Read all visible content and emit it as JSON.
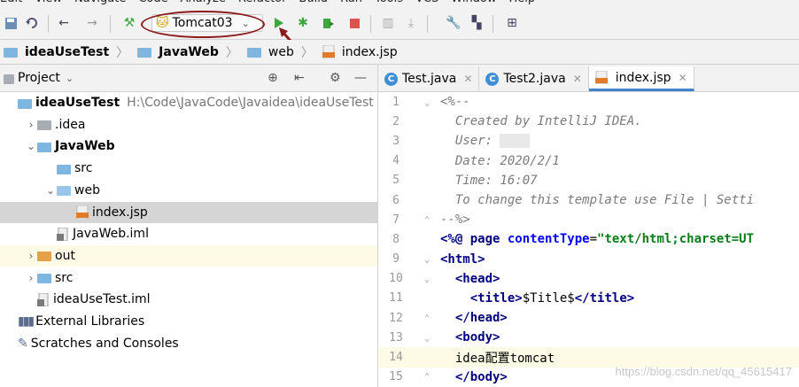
{
  "menu": [
    "Edit",
    "View",
    "Navigate",
    "Code",
    "Analyze",
    "Refactor",
    "Build",
    "Run",
    "Tools",
    "VCS",
    "Window",
    "Help"
  ],
  "toolbar": {
    "run_config": "Tomcat03",
    "icons": [
      "save-icon",
      "sync-icon",
      "back-icon",
      "forward-icon",
      "build-icon",
      "run-icon",
      "debug-icon",
      "coverage-icon",
      "stop-icon",
      "vcs-update-icon",
      "vcs-commit-icon",
      "settings-icon",
      "project-structure-icon",
      "sdk-icon"
    ]
  },
  "breadcrumbs": [
    {
      "label": "ideaUseTest",
      "bold": true
    },
    {
      "label": "JavaWeb",
      "bold": true
    },
    {
      "label": "web",
      "bold": false
    },
    {
      "label": "index.jsp",
      "bold": false
    }
  ],
  "project": {
    "header_label": "Project",
    "tree": [
      {
        "label": "ideaUseTest",
        "path": "H:\\Code\\JavaCode\\Javaidea\\ideaUseTest",
        "indent": 0,
        "chev": "",
        "icon": "module-folder",
        "bold": true
      },
      {
        "label": ".idea",
        "indent": 1,
        "chev": "›",
        "icon": "folder-grey"
      },
      {
        "label": "JavaWeb",
        "indent": 1,
        "chev": "⌄",
        "icon": "module-folder",
        "bold": true
      },
      {
        "label": "src",
        "indent": 2,
        "chev": "",
        "icon": "folder-blue"
      },
      {
        "label": "web",
        "indent": 2,
        "chev": "⌄",
        "icon": "folder-web"
      },
      {
        "label": "index.jsp",
        "indent": 3,
        "chev": "",
        "icon": "jsp-file",
        "selected": true
      },
      {
        "label": "JavaWeb.iml",
        "indent": 2,
        "chev": "",
        "icon": "iml-file"
      },
      {
        "label": "out",
        "indent": 1,
        "chev": "›",
        "icon": "folder-orange",
        "highlight": true
      },
      {
        "label": "src",
        "indent": 1,
        "chev": "›",
        "icon": "folder-blue"
      },
      {
        "label": "ideaUseTest.iml",
        "indent": 1,
        "chev": "",
        "icon": "iml-file"
      },
      {
        "label": "External Libraries",
        "indent": 0,
        "chev": "",
        "icon": "libraries"
      },
      {
        "label": "Scratches and Consoles",
        "indent": 0,
        "chev": "",
        "icon": "scratches"
      }
    ]
  },
  "editor": {
    "tabs": [
      {
        "label": "Test.java",
        "icon": "class-icon",
        "active": false
      },
      {
        "label": "Test2.java",
        "icon": "class-icon",
        "active": false
      },
      {
        "label": "index.jsp",
        "icon": "jsp-file",
        "active": true
      }
    ],
    "lines": [
      {
        "n": "1",
        "fold": "⌄",
        "html": "<span class='cmt'>&lt;%--</span>"
      },
      {
        "n": "2",
        "fold": "",
        "html": "<span class='cmt'>  Created by IntelliJ IDEA.</span>"
      },
      {
        "n": "3",
        "fold": "",
        "html": "<span class='cmt'>  User: </span><span style='background:#e8e8e8;color:#e8e8e8'>&#8203;xxxx</span>"
      },
      {
        "n": "4",
        "fold": "",
        "html": "<span class='cmt'>  Date: 2020/2/1</span>"
      },
      {
        "n": "5",
        "fold": "",
        "html": "<span class='cmt'>  Time: 16:07</span>"
      },
      {
        "n": "6",
        "fold": "",
        "html": "<span class='cmt'>  To change this template use File | Setti</span>"
      },
      {
        "n": "7",
        "fold": "⌃",
        "html": "<span class='cmt'>--%&gt;</span>"
      },
      {
        "n": "8",
        "fold": "",
        "html": "<span class='tag'>&lt;%@ page </span><span class='attr'>contentType</span>=<span class='str'>\"text/html;charset=UT</span>"
      },
      {
        "n": "9",
        "fold": "⌄",
        "html": "<span class='tag'>&lt;html&gt;</span>"
      },
      {
        "n": "10",
        "fold": "⌄",
        "html": "  <span class='tag'>&lt;head&gt;</span>"
      },
      {
        "n": "11",
        "fold": "",
        "html": "    <span class='tag'>&lt;title&gt;</span>$Title$<span class='tag'>&lt;/title&gt;</span>"
      },
      {
        "n": "12",
        "fold": "⌃",
        "html": "  <span class='tag'>&lt;/head&gt;</span>"
      },
      {
        "n": "13",
        "fold": "⌄",
        "html": "  <span class='tag'>&lt;body&gt;</span>"
      },
      {
        "n": "14",
        "fold": "",
        "html": "  idea配置tomcat",
        "current": true
      },
      {
        "n": "15",
        "fold": "⌃",
        "html": "  <span class='tag'>&lt;/body&gt;</span>"
      }
    ]
  },
  "watermark": "https://blog.csdn.net/qq_45615417",
  "colors": {
    "run": "#3aa83a",
    "stop": "#d9534f",
    "annotation": "#8b1a1a",
    "accent": "#4083c9"
  }
}
